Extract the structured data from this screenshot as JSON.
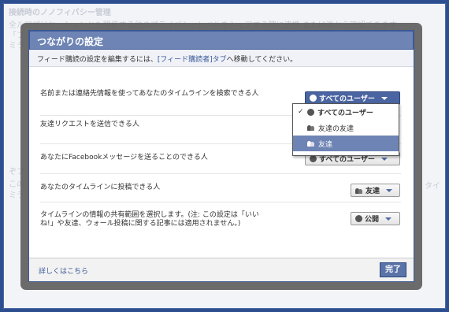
{
  "background": {
    "lines": [
      "接続時のノノフィバシー管理",
      "全ルアプリケーションとも関係する他のプライバシーレベルをシェアする際に連携 または強から確認できます",
      "「プライバシー設定",
      "ミラ",
      "ぞフ",
      "この",
      "ミラ",
      "タイ"
    ]
  },
  "dialog": {
    "title": "つながりの設定",
    "info_prefix": "フィード購読の設定を編集するには、",
    "info_link": "[フィード購読者]タブ",
    "info_suffix": "へ移動してください。",
    "rows": [
      {
        "label": "名前または連絡先情報を使ってあなたのタイムラインを検索できる人",
        "value": "すべてのユーザー"
      },
      {
        "label": "友達リクエストを送信できる人",
        "value": ""
      },
      {
        "label": "あなたにFacebookメッセージを送ることのできる人",
        "value": "すべてのユーザー"
      },
      {
        "label": "あなたのタイムラインに投稿できる人",
        "value": "友達"
      },
      {
        "label": "タイムラインの情報の共有範囲を選択します。(注: この設定は「いいね!」や友達、ウォール投稿に関する記事には適用されません。)",
        "value": "公開"
      }
    ],
    "menu": {
      "items": [
        {
          "label": "すべてのユーザー",
          "icon": "globe-icon",
          "checked": true
        },
        {
          "label": "友達の友達",
          "icon": "people-icon",
          "checked": false
        },
        {
          "label": "友達",
          "icon": "people-icon",
          "checked": false,
          "highlighted": true
        }
      ]
    },
    "footer": {
      "more_link": "詳しくはこちら",
      "done_label": "完了"
    }
  },
  "colors": {
    "header": "#6d84b4",
    "border": "#3b5998",
    "link": "#3b5998",
    "highlight": "#6d84b4"
  }
}
